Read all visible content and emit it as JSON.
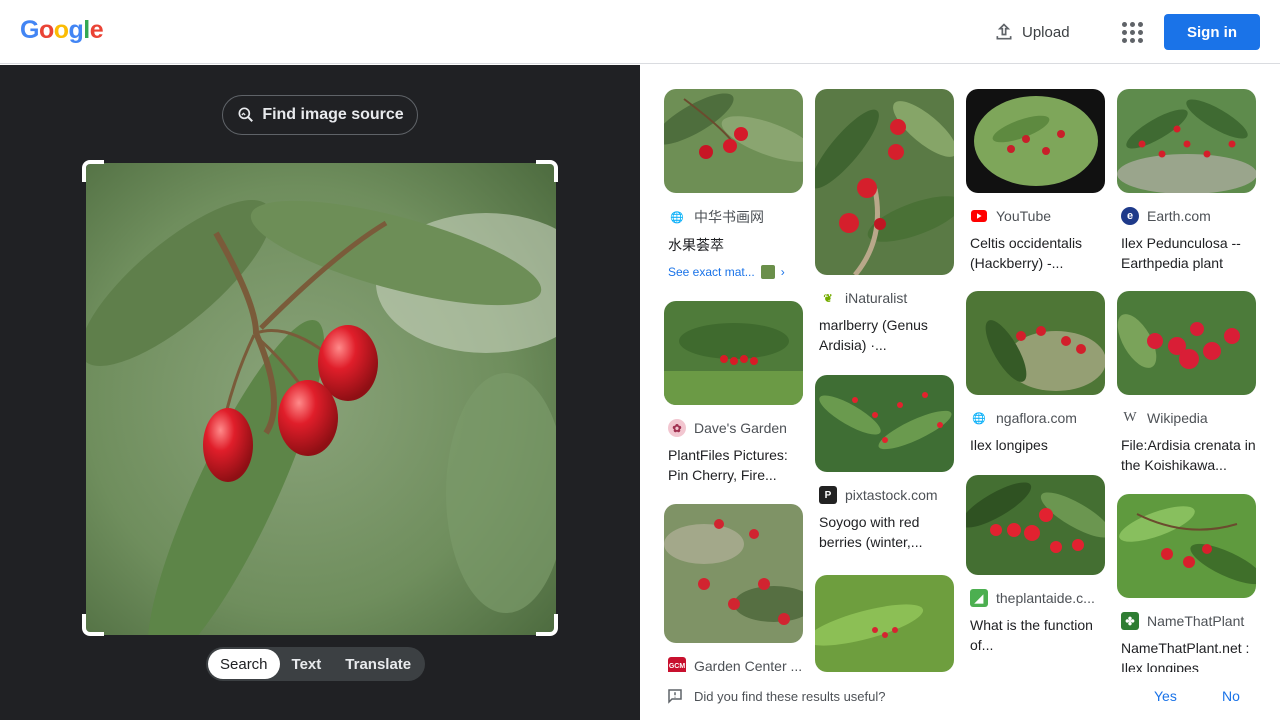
{
  "header": {
    "logo_letters": [
      {
        "ch": "G",
        "color": "#4285F4"
      },
      {
        "ch": "o",
        "color": "#EA4335"
      },
      {
        "ch": "o",
        "color": "#FBBC05"
      },
      {
        "ch": "g",
        "color": "#4285F4"
      },
      {
        "ch": "l",
        "color": "#34A853"
      },
      {
        "ch": "e",
        "color": "#EA4335"
      }
    ],
    "upload_label": "Upload",
    "signin_label": "Sign in"
  },
  "left": {
    "find_source_label": "Find image source",
    "modes": [
      "Search",
      "Text",
      "Translate"
    ],
    "active_mode": "Search"
  },
  "results": [
    {
      "source": "中华书画网",
      "favicon": "globe",
      "title": "水果荟萃",
      "exact": "See exact mat..."
    },
    {
      "source": "iNaturalist",
      "favicon": "inaturalist",
      "title": "marlberry (Genus Ardisia) ·..."
    },
    {
      "source": "YouTube",
      "favicon": "youtube",
      "title": "Celtis occidentalis (Hackberry) -..."
    },
    {
      "source": "Earth.com",
      "favicon": "earth",
      "title": "Ilex Pedunculosa -- Earthpedia plant"
    },
    {
      "source": "Dave's Garden",
      "favicon": "davesgarden",
      "title": "PlantFiles Pictures: Pin Cherry, Fire..."
    },
    {
      "source": "pixtastock.com",
      "favicon": "pixtastock",
      "title": "Soyogo with red berries (winter,..."
    },
    {
      "source": "ngaflora.com",
      "favicon": "globe",
      "title": "Ilex longipes"
    },
    {
      "source": "Wikipedia",
      "favicon": "wikipedia",
      "title": "File:Ardisia crenata in the Koishikawa..."
    },
    {
      "source": "Garden Center ...",
      "favicon": "gcm",
      "title": ""
    },
    {
      "source": "theplantaide.c...",
      "favicon": "plantaide",
      "title": "What is the function of..."
    },
    {
      "source": "NameThatPlant",
      "favicon": "namethatplant",
      "title": "NameThatPlant.net : Ilex longipes"
    }
  ],
  "feedback": {
    "question": "Did you find these results useful?",
    "yes": "Yes",
    "no": "No"
  },
  "colors": {
    "accent": "#1a73e8",
    "left_bg": "#202124"
  }
}
